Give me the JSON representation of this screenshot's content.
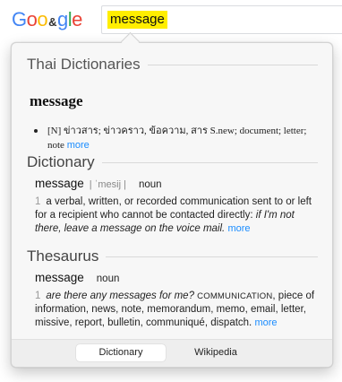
{
  "search": {
    "logo": [
      "Goo",
      "&",
      "gle"
    ],
    "query": "message"
  },
  "sections": {
    "thai": {
      "heading": "Thai Dictionaries",
      "word": "message",
      "definition": "[N] ข่าวสาร; ข่าวคราว, ข้อความ, สาร S.new; document; letter; note",
      "more": "more"
    },
    "dictionary": {
      "heading": "Dictionary",
      "word": "message",
      "pronunciation": "| ˈmesij |",
      "pos": "noun",
      "sense_number": "1",
      "definition": "a verbal, written, or recorded communication sent to or left for a recipient who cannot be contacted directly:",
      "example": "if I'm not there, leave a message on the voice mail.",
      "more": "more"
    },
    "thesaurus": {
      "heading": "Thesaurus",
      "word": "message",
      "pos": "noun",
      "sense_number": "1",
      "example": "are there any messages for me?",
      "tag": "COMMUNICATION",
      "synonyms": ", piece of information, news, note, memorandum, memo, email, letter, missive, report, bulletin, communiqué, dispatch.",
      "more": "more"
    }
  },
  "tabs": [
    {
      "label": "Dictionary",
      "active": true
    },
    {
      "label": "Wikipedia",
      "active": false
    }
  ],
  "colors": {
    "highlight": "#ffee00",
    "link": "#1a8cff",
    "popover_bg": "#f7f7f7",
    "logo": [
      "#4285f4",
      "#ea4335",
      "#fbbc05",
      "#333333",
      "#4285f4",
      "#34a853",
      "#ea4335"
    ]
  }
}
